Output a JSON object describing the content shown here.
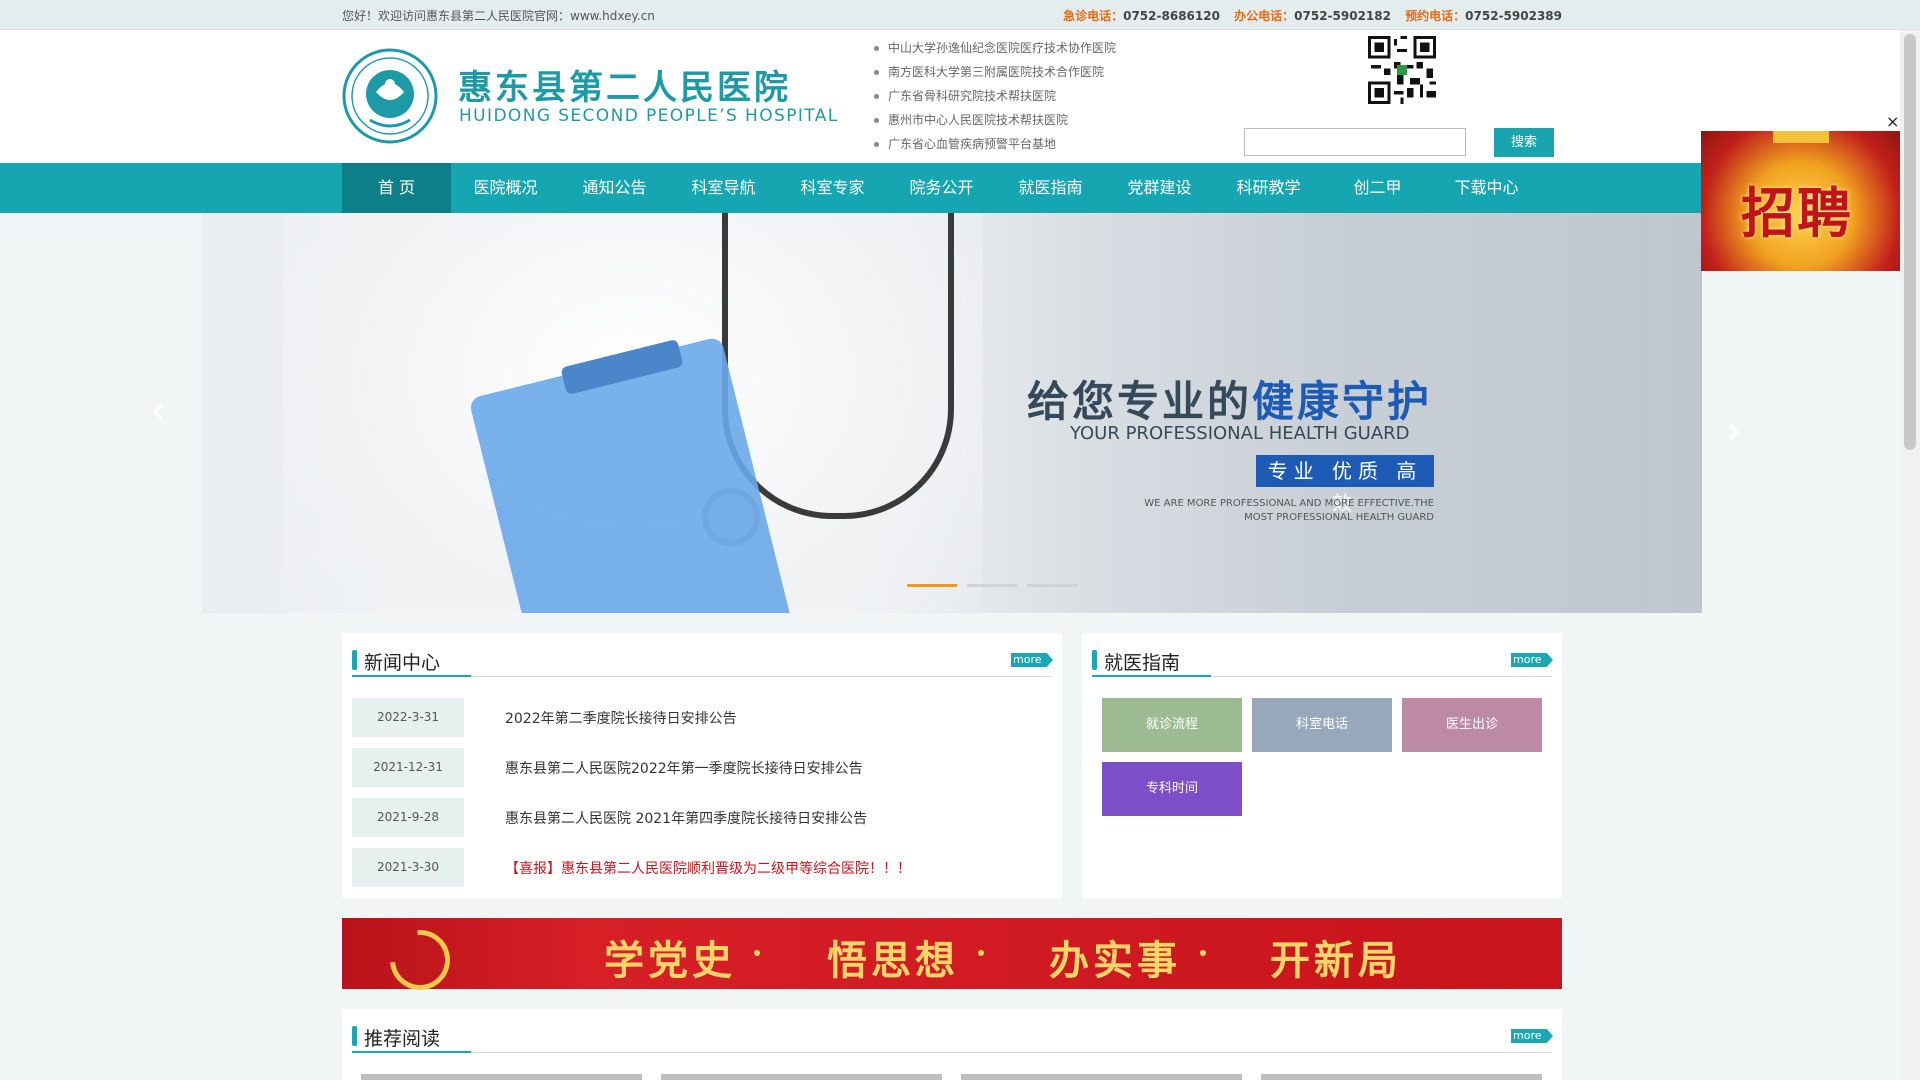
{
  "topbar": {
    "welcome": "您好！欢迎访问惠东县第二人民医院官网：www.hdxey.cn",
    "phones": [
      {
        "label": "急诊电话：",
        "number": "0752-8686120"
      },
      {
        "label": "办公电话：",
        "number": "0752-5902182"
      },
      {
        "label": "预约电话：",
        "number": "0752-5902389"
      }
    ]
  },
  "header": {
    "logo_cn": "惠东县第二人民医院",
    "logo_en": "HUIDONG SECOND PEOPLE’S HOSPITAL",
    "partners": [
      "中山大学孙逸仙纪念医院医疗技术协作医院",
      "南方医科大学第三附属医院技术合作医院",
      "广东省骨科研究院技术帮扶医院",
      "惠州市中心人民医院技术帮扶医院",
      "广东省心血管疾病预警平台基地"
    ],
    "search_placeholder": "",
    "search_button": "搜索"
  },
  "nav": [
    "首 页",
    "医院概况",
    "通知公告",
    "科室导航",
    "科室专家",
    "院务公开",
    "就医指南",
    "党群建设",
    "科研教学",
    "创二甲",
    "下载中心"
  ],
  "banner": {
    "slogan_cn_a": "给您专业的",
    "slogan_cn_b": "健康守护",
    "slogan_en": "YOUR PROFESSIONAL HEALTH GUARD",
    "slogan_box": "专业 优质 高效",
    "slogan_small_1": "WE ARE MORE PROFESSIONAL AND MORE EFFECTIVE.THE",
    "slogan_small_2": "MOST PROFESSIONAL HEALTH GUARD",
    "prev": "‹",
    "next": "›"
  },
  "side_ad": {
    "text": "招聘",
    "close": "×"
  },
  "news": {
    "title": "新闻中心",
    "more": "more",
    "items": [
      {
        "date": "2022-3-31",
        "title": "2022年第二季度院长接待日安排公告"
      },
      {
        "date": "2021-12-31",
        "title": "惠东县第二人民医院2022年第一季度院长接待日安排公告"
      },
      {
        "date": "2021-9-28",
        "title": "惠东县第二人民医院 2021年第四季度院长接待日安排公告"
      },
      {
        "date": "2021-3-30",
        "title": "【喜报】惠东县第二人民医院顺利晋级为二级甲等综合医院！！！"
      }
    ]
  },
  "guide": {
    "title": "就医指南",
    "more": "more",
    "tiles": [
      {
        "label": "就诊流程",
        "color": "#9dbb92"
      },
      {
        "label": "科室电话",
        "color": "#98a8bc"
      },
      {
        "label": "医生出诊",
        "color": "#bd8aa6"
      },
      {
        "label": "专科时间",
        "color": "#7d4fc6"
      }
    ]
  },
  "party_banner": [
    "学党史",
    "悟思想",
    "办实事",
    "开新局"
  ],
  "recommend": {
    "title": "推荐阅读",
    "more": "more"
  }
}
